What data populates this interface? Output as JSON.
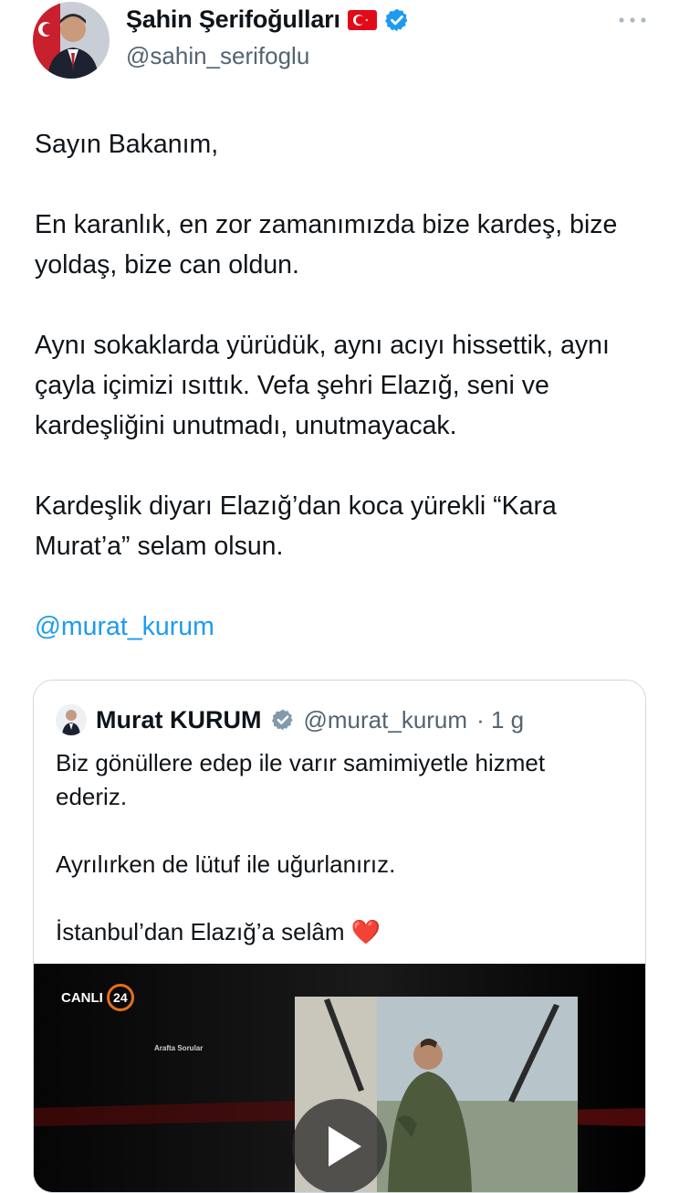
{
  "author": {
    "name": "Şahin Şerifoğulları",
    "handle": "@sahin_serifoglu",
    "flag_icon": "turkey-flag-icon",
    "verified_icon": "verified-badge-icon"
  },
  "tweet": {
    "paragraphs": [
      "Sayın Bakanım,",
      "En karanlık, en zor zamanımızda bize kardeş, bize yoldaş, bize can oldun.",
      "Aynı sokaklarda yürüdük, aynı acıyı hissettik, aynı çayla içimizi ısıttık. Vefa şehri Elazığ, seni ve kardeşliğini unutmadı, unutmayacak.",
      "Kardeşlik diyarı Elazığ’dan koca yürekli “Kara Murat’a” selam olsun."
    ],
    "mention": "@murat_kurum"
  },
  "quote": {
    "name": "Murat KURUM",
    "handle": "@murat_kurum",
    "time": "· 1 g",
    "paragraphs": [
      "Biz gönüllere edep ile varır samimiyetle hizmet ederiz.",
      "Ayrılırken de lütuf ile uğurlanırız.",
      "İstanbul’dan Elazığ’a selâm ❤️"
    ],
    "video": {
      "channel_label": "CANLI",
      "channel_number": "24",
      "program": "Arafta Sorular"
    }
  },
  "colors": {
    "link": "#1d9bf0",
    "secondary_text": "#536471",
    "border": "#cfd9de",
    "verified": "#1d9bf0"
  }
}
